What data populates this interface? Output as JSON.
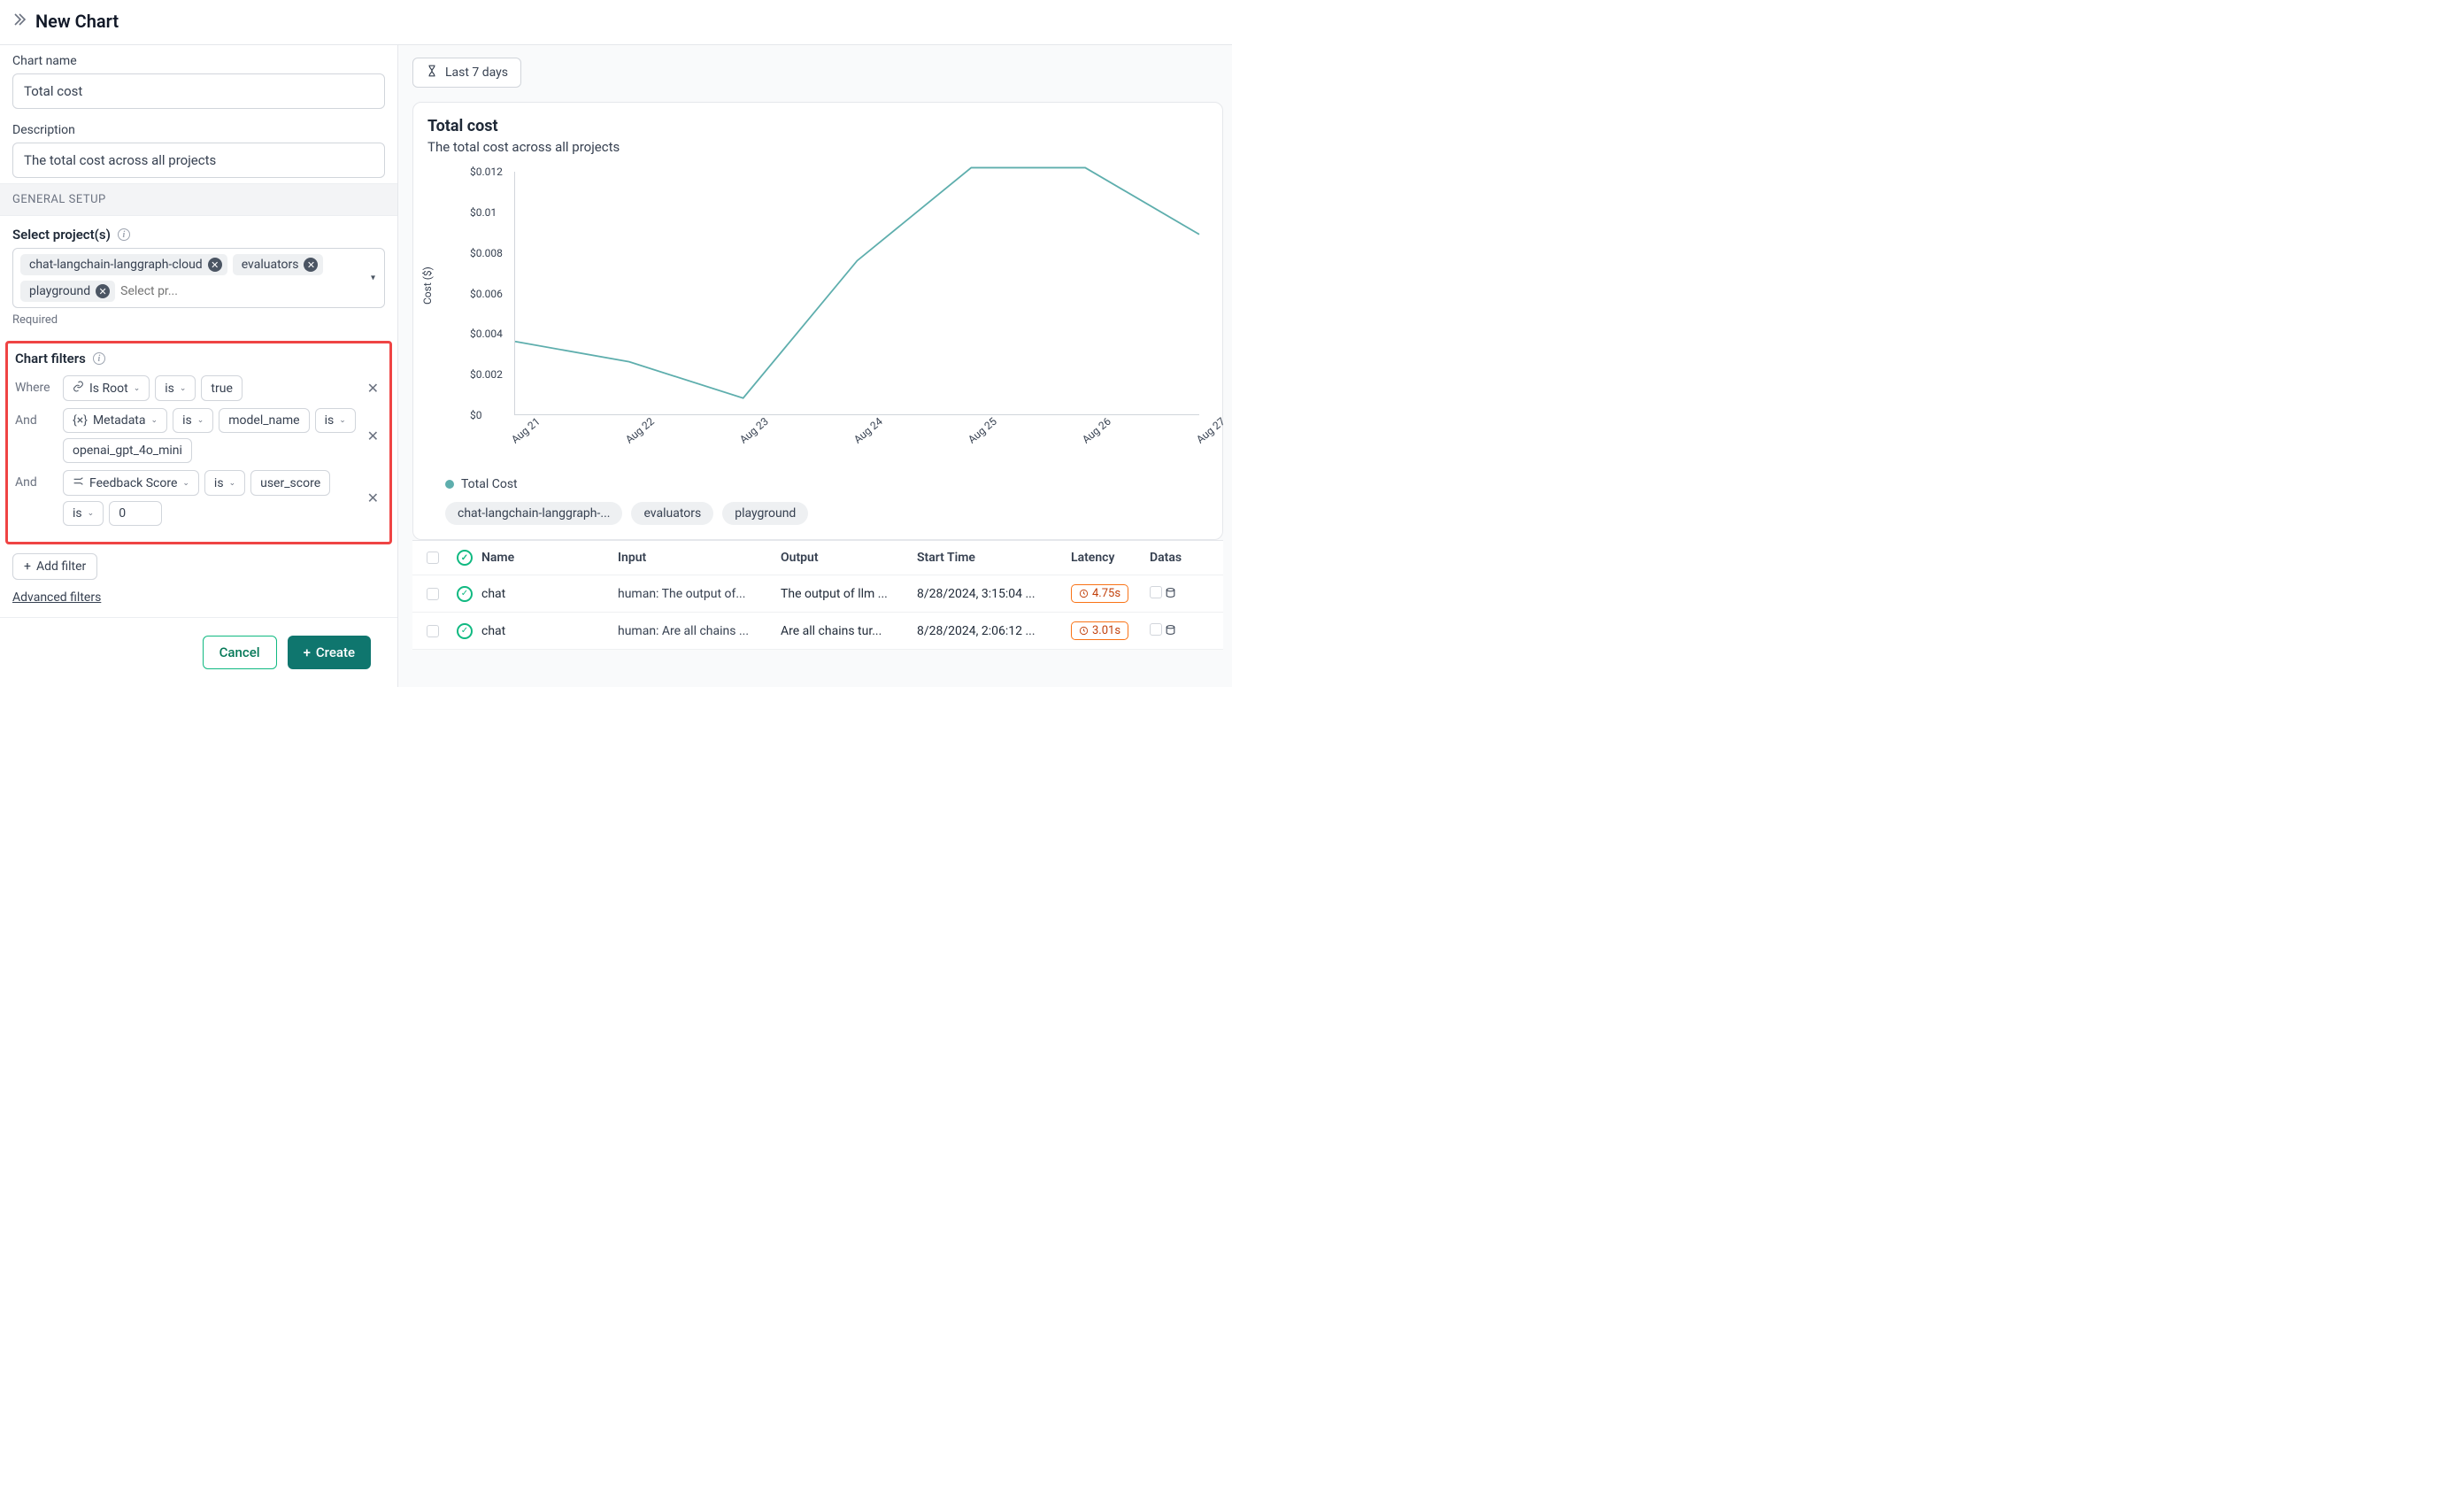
{
  "header": {
    "title": "New Chart"
  },
  "form": {
    "name_label": "Chart name",
    "name_value": "Total cost",
    "desc_label": "Description",
    "desc_value": "The total cost across all projects",
    "general_setup": "GENERAL SETUP",
    "projects_label": "Select project(s)",
    "projects_required": "Required",
    "projects_placeholder": "Select pr...",
    "projects": [
      "chat-langchain-langgraph-cloud",
      "evaluators",
      "playground"
    ]
  },
  "filters": {
    "title": "Chart filters",
    "where_kw": "Where",
    "and_kw": "And",
    "add_filter": "Add filter",
    "advanced": "Advanced filters",
    "rows": [
      {
        "field": "Is Root",
        "op1": "is",
        "val1": "true"
      },
      {
        "field": "Metadata",
        "op1": "is",
        "val1": "model_name",
        "op2": "is",
        "val2": "openai_gpt_4o_mini"
      },
      {
        "field": "Feedback Score",
        "op1": "is",
        "val1": "user_score",
        "op2": "is",
        "val2": "0"
      }
    ]
  },
  "footer": {
    "cancel": "Cancel",
    "create": "Create"
  },
  "preview": {
    "range": "Last 7 days",
    "title": "Total cost",
    "subtitle": "The total cost across all projects",
    "legend": "Total Cost",
    "project_chips": [
      "chat-langchain-langgraph-...",
      "evaluators",
      "playground"
    ]
  },
  "chart_data": {
    "type": "line",
    "title": "Total cost",
    "ylabel": "Cost ($)",
    "xlabel": "",
    "ylim": [
      0,
      0.012
    ],
    "x": [
      "Aug 21",
      "Aug 22",
      "Aug 23",
      "Aug 24",
      "Aug 25",
      "Aug 26",
      "Aug 27"
    ],
    "series": [
      {
        "name": "Total Cost",
        "values": [
          0.0036,
          0.0026,
          0.0008,
          0.0076,
          0.0122,
          0.0122,
          0.0089
        ]
      }
    ],
    "yticks": [
      "$0",
      "$0.002",
      "$0.004",
      "$0.006",
      "$0.008",
      "$0.01",
      "$0.012"
    ]
  },
  "table": {
    "headers": {
      "name": "Name",
      "input": "Input",
      "output": "Output",
      "start": "Start Time",
      "latency": "Latency",
      "dataset": "Datas"
    },
    "rows": [
      {
        "name": "chat",
        "input": "human: The output of...",
        "output": "The output of llm ...",
        "start": "8/28/2024, 3:15:04 ...",
        "latency": "4.75s"
      },
      {
        "name": "chat",
        "input": "human: Are all chains ...",
        "output": "Are all chains tur...",
        "start": "8/28/2024, 2:06:12 ...",
        "latency": "3.01s"
      }
    ]
  }
}
